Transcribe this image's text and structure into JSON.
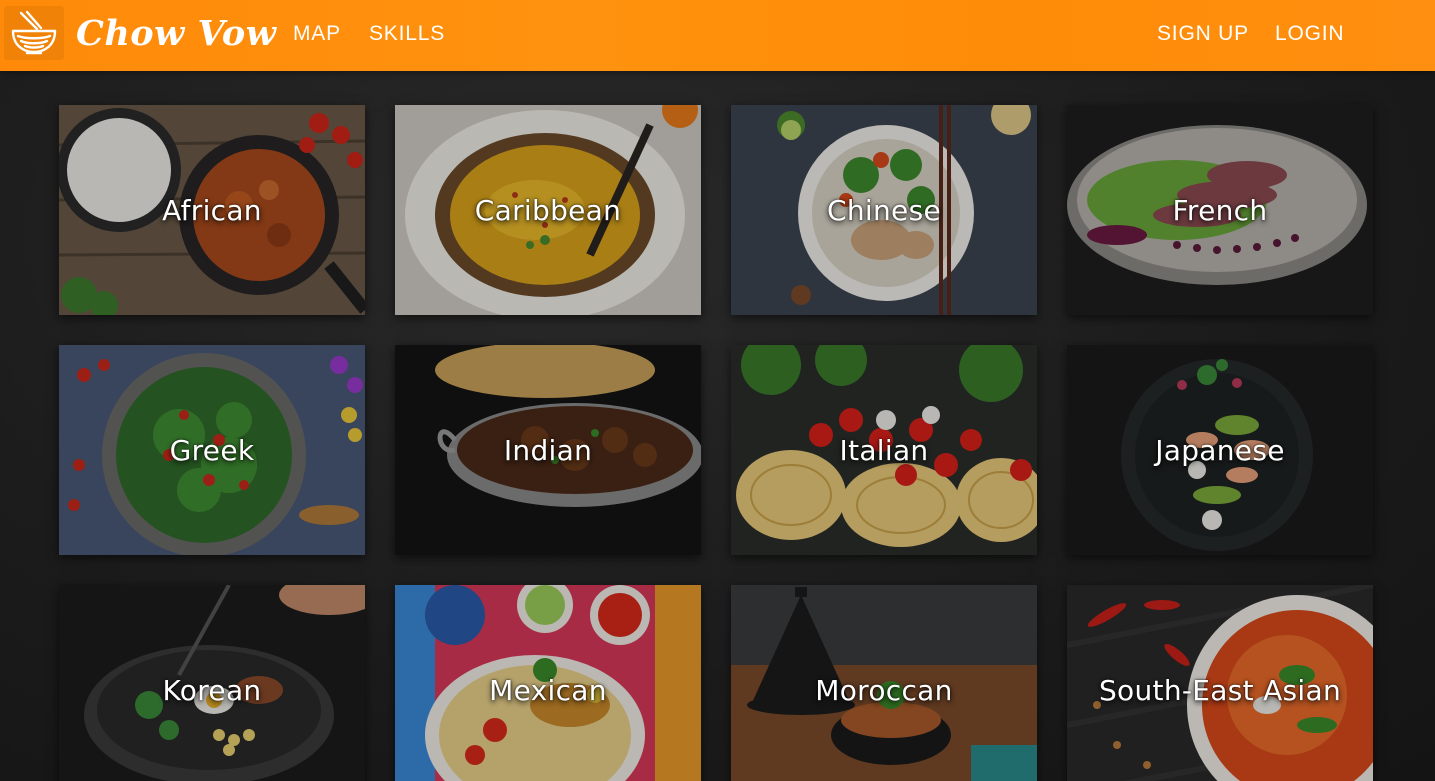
{
  "header": {
    "brand": "Chow Vow",
    "logo_icon": "noodle-bowl-icon",
    "nav_left": [
      {
        "label": "MAP"
      },
      {
        "label": "SKILLS"
      }
    ],
    "nav_right": [
      {
        "label": "SIGN UP"
      },
      {
        "label": "LOGIN"
      }
    ]
  },
  "colors": {
    "header_orange": "#ff8e0c",
    "background": "#1c1c1c",
    "label_text": "#ffffff"
  },
  "cuisines": [
    {
      "label": "African"
    },
    {
      "label": "Caribbean"
    },
    {
      "label": "Chinese"
    },
    {
      "label": "French"
    },
    {
      "label": "Greek"
    },
    {
      "label": "Indian"
    },
    {
      "label": "Italian"
    },
    {
      "label": "Japanese"
    },
    {
      "label": "Korean"
    },
    {
      "label": "Mexican"
    },
    {
      "label": "Moroccan"
    },
    {
      "label": "South-East Asian"
    }
  ]
}
